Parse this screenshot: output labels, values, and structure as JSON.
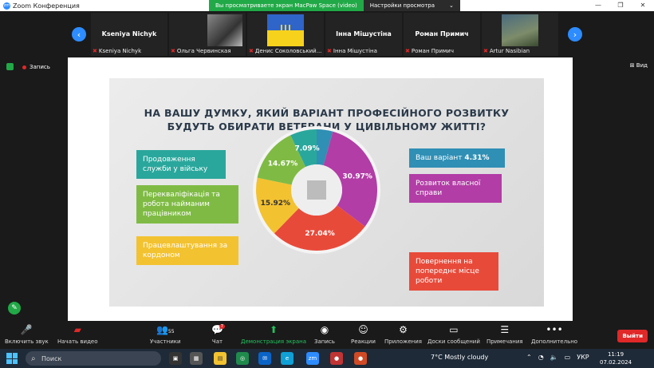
{
  "titlebar": {
    "app_title": "Zoom Конференция",
    "logo_text": "zm"
  },
  "banner": {
    "message": "Вы просматриваете экран MacPaw Space (video)",
    "options_label": "Настройки просмотра",
    "options_chevron": "⌄"
  },
  "window_controls": {
    "minimize": "—",
    "restore": "❐",
    "close": "✕"
  },
  "participants": [
    {
      "bigname": "Kseniya Nichyk",
      "caption": "Kseniya Nichyk",
      "photo": "none"
    },
    {
      "bigname": "",
      "caption": "Ольга Червинская",
      "photo": "grey-portrait"
    },
    {
      "bigname": "",
      "caption": "Денис Соколовський...",
      "photo": "ukraine-flag"
    },
    {
      "bigname": "Інна Мішустіна",
      "caption": "Інна Мішустіна",
      "photo": "none"
    },
    {
      "bigname": "Роман Примич",
      "caption": "Роман Примич",
      "photo": "none"
    },
    {
      "bigname": "",
      "caption": "Artur Nasibian",
      "photo": "soldier"
    }
  ],
  "nav": {
    "prev_icon": "chevron-left-icon",
    "next_icon": "chevron-right-icon",
    "prev_glyph": "‹",
    "next_glyph": "›"
  },
  "recording": {
    "label": "Запись"
  },
  "view": {
    "label": "⊞ Вид"
  },
  "slide": {
    "question_line1": "НА ВАШУ ДУМКУ, ЯКИЙ ВАРІАНТ ПРОФЕСІЙНОГО РОЗВИТКУ",
    "question_line2": "БУДУТЬ ОБИРАТИ ВЕТЕРАНИ У ЦИВІЛЬНОМУ ЖИТТІ?",
    "labels": {
      "l1": "Продовження служби у війську",
      "l2": "Перекваліфікація та робота найманим працівником",
      "l3": "Працевлаштування за кордоном",
      "r1_text": "Ваш варіант ",
      "r1_value": "4.31%",
      "r2": "Розвиток власної справи",
      "r3": "Повернення на попереднє місце роботи"
    }
  },
  "chart_data": {
    "type": "pie",
    "categories": [
      "Ваш варіант",
      "Розвиток власної справи",
      "Повернення на попереднє місце роботи",
      "Працевлаштування за кордоном",
      "Перекваліфікація та робота найманим працівником",
      "Продовження служби у війську"
    ],
    "values": [
      4.31,
      30.97,
      27.04,
      15.92,
      14.67,
      7.09
    ],
    "labels": [
      "",
      "30.97%",
      "27.04%",
      "15.92%",
      "14.67%",
      "7.09%"
    ],
    "colors": [
      "#2f8fb5",
      "#b23da6",
      "#e84a3a",
      "#f3c230",
      "#7fbb44",
      "#2aa79c"
    ]
  },
  "toolbar": {
    "audio": "Включить звук",
    "video": "Начать видео",
    "participants": "Участники",
    "participants_count": "55",
    "chat": "Чат",
    "chat_badge": "7",
    "share": "Демонстрация экрана",
    "record": "Запись",
    "reactions": "Реакции",
    "apps": "Приложения",
    "whiteboard": "Доски сообщений",
    "notes": "Примечания",
    "more": "Дополнительно",
    "leave": "Выйти"
  },
  "taskbar": {
    "search": "Поиск",
    "weather": "7°C  Mostly cloudy",
    "lang": "УКР",
    "time": "11:19",
    "date": "07.02.2024"
  }
}
